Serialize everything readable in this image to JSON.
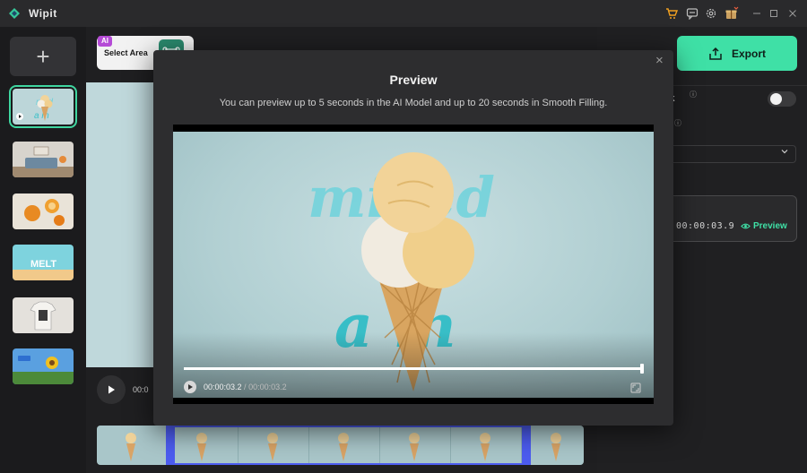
{
  "app": {
    "name": "Wipit"
  },
  "toolbar_icons": [
    "cart-icon",
    "feedback-icon",
    "settings-icon",
    "gift-icon",
    "minimize-icon",
    "maximize-icon",
    "close-icon"
  ],
  "sidebar": {
    "add_label": "+",
    "thumbnails": [
      {
        "name": "ice-cream",
        "active": true,
        "text": ""
      },
      {
        "name": "living-room",
        "active": false,
        "text": ""
      },
      {
        "name": "oranges",
        "active": false,
        "text": ""
      },
      {
        "name": "melt",
        "active": false,
        "text": "MELT"
      },
      {
        "name": "tshirt",
        "active": false,
        "text": ""
      },
      {
        "name": "sunflower-girl",
        "active": false,
        "text": ""
      }
    ]
  },
  "toolbar": {
    "ai_badge": "AI",
    "select_area_label": "Select Area"
  },
  "player": {
    "time_partial": "00:0"
  },
  "right_panel": {
    "export_label": "Export",
    "watermark_label": "ark",
    "time": "00:00:03.9",
    "preview_label": "Preview"
  },
  "modal": {
    "title": "Preview",
    "description": "You can preview up to 5 seconds in the AI Model and up to 20 seconds in Smooth Filling.",
    "close_symbol": "×",
    "current_time": "00:00:03.2",
    "separator": " / ",
    "duration": "00:00:03.2",
    "progress": 1.0,
    "video_text_top": "mixed",
    "video_text_bottom": "a m"
  },
  "colors": {
    "accent": "#3fe0a6",
    "selection": "#4c5cf0",
    "ai": "#b54bd6"
  }
}
